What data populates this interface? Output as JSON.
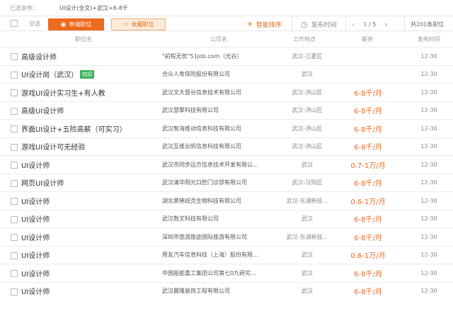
{
  "filter": {
    "label": "已选条件：",
    "criteria": "UI设计(全文)+武汉+6-8千"
  },
  "toolbar": {
    "select_all": "全选",
    "apply_label": "申请职位",
    "favorite_label": "收藏职位",
    "smart_sort": "智能排序",
    "date_sort": "发布时间",
    "page_current": "1",
    "page_sep": " / ",
    "page_total": "5",
    "total_text": "共201条职位"
  },
  "columns": {
    "title": "职位名",
    "company": "公司名",
    "location": "工作地点",
    "salary": "薪资",
    "date": "发布时间"
  },
  "jobs": [
    {
      "title": "高级设计师",
      "badge": "",
      "company": "\"前程无忧\"51job.com（光谷）",
      "location": "武汉-江夏区",
      "salary": "",
      "date": "12-30"
    },
    {
      "title": "UI设计岗（武汉）",
      "badge": "校招",
      "company": "合众人寿保险股份有限公司",
      "location": "武汉",
      "salary": "",
      "date": "12-30"
    },
    {
      "title": "游戏UI设计实习生+有人教",
      "badge": "",
      "company": "武汉文大慧谷信息技术有限公司",
      "location": "武汉-洪山区",
      "salary": "6-8千/月",
      "date": "12-30"
    },
    {
      "title": "高级UI设计师",
      "badge": "",
      "company": "武汉慧擎科技有限公司",
      "location": "武汉-洪山区",
      "salary": "6-8千/月",
      "date": "12-30"
    },
    {
      "title": "界面UI设计+五险高薪（可实习）",
      "badge": "",
      "company": "武汉智海维动信息科技有限公司",
      "location": "武汉-洪山区",
      "salary": "6-8千/月",
      "date": "12-30"
    },
    {
      "title": "游戏UI设计可无经验",
      "badge": "",
      "company": "武汉互维云帆信息科技有限公司",
      "location": "武汉-洪山区",
      "salary": "6-8千/月",
      "date": "12-30"
    },
    {
      "title": "UI设计师",
      "badge": "",
      "company": "武汉市同步远方信息技术开发有限公...",
      "location": "武汉",
      "salary": "0.7-1万/月",
      "date": "12-30"
    },
    {
      "title": "网页UI设计师",
      "badge": "",
      "company": "武汉清华阳光口腔门诊部有限公司",
      "location": "武汉-汉阳区",
      "salary": "6-8千/月",
      "date": "12-30"
    },
    {
      "title": "UI设计师",
      "badge": "",
      "company": "湖北莱佛班克生物科技有限公司",
      "location": "武汉-东湖新技...",
      "salary": "0.6-1万/月",
      "date": "12-30"
    },
    {
      "title": "UI设计师",
      "badge": "",
      "company": "武汉数文科技有限公司",
      "location": "武汉",
      "salary": "6-8千/月",
      "date": "12-30"
    },
    {
      "title": "UI设计师",
      "badge": "",
      "company": "深圳市悠游旅途国际旅游有限公司",
      "location": "武汉-东湖新技...",
      "salary": "6-8千/月",
      "date": "12-30"
    },
    {
      "title": "UI设计师",
      "badge": "",
      "company": "用友汽车信息科技（上海）股份有限...",
      "location": "武汉",
      "salary": "0.6-1万/月",
      "date": "12-30"
    },
    {
      "title": "UI设计师",
      "badge": "",
      "company": "中国船舶重工集团公司第七0九研究...",
      "location": "武汉",
      "salary": "6-8千/月",
      "date": "12-30"
    },
    {
      "title": "UI设计师",
      "badge": "",
      "company": "武汉晨隆装饰工程有限公司",
      "location": "武汉",
      "salary": "6-8千/月",
      "date": "12-30"
    }
  ]
}
